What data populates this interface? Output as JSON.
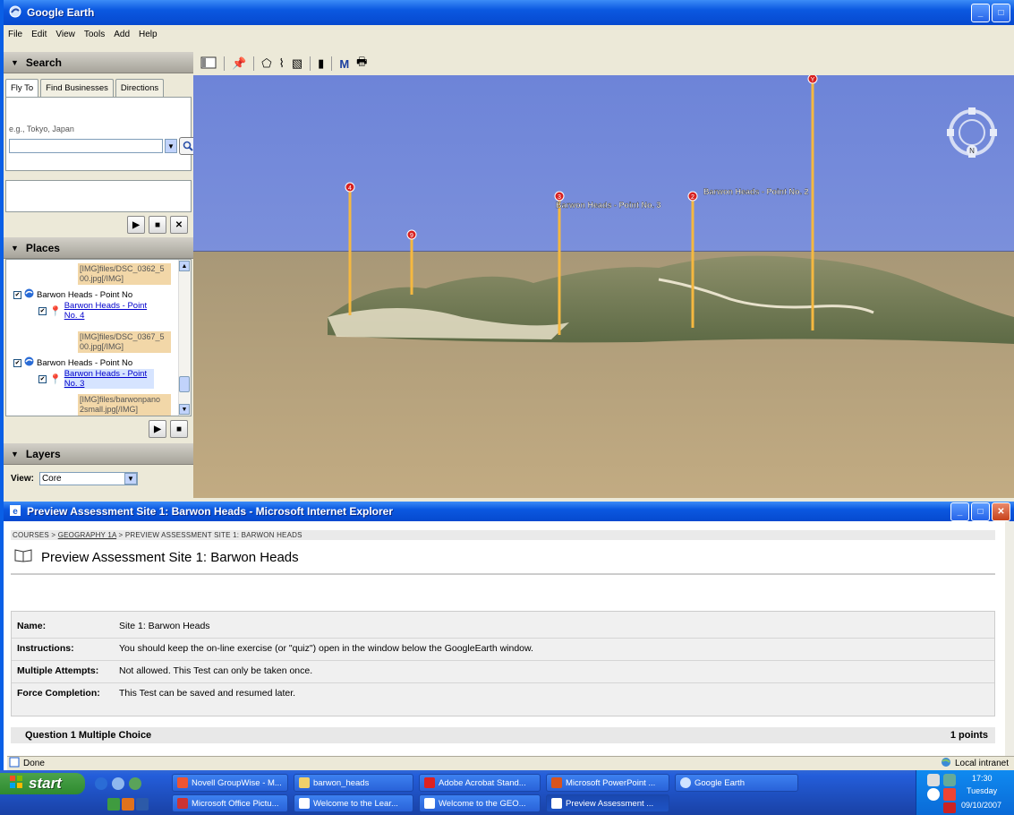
{
  "ge": {
    "title": "Google Earth",
    "menu": [
      "File",
      "Edit",
      "View",
      "Tools",
      "Add",
      "Help"
    ],
    "search": {
      "heading": "Search",
      "tabs": [
        "Fly To",
        "Find Businesses",
        "Directions"
      ],
      "hint": "e.g., Tokyo, Japan",
      "value": ""
    },
    "places": {
      "heading": "Places",
      "rows": [
        {
          "kind": "img",
          "text": "[IMG]files/DSC_0362_5 00.jpg[/IMG]"
        },
        {
          "kind": "folder",
          "text": "Barwon Heads - Point No"
        },
        {
          "kind": "pin",
          "text": "Barwon Heads - Point No. 4"
        },
        {
          "kind": "img",
          "text": "[IMG]files/DSC_0367_5 00.jpg[/IMG]"
        },
        {
          "kind": "folder",
          "text": "Barwon Heads - Point No"
        },
        {
          "kind": "pin",
          "text": "Barwon Heads - Point No. 3"
        },
        {
          "kind": "img",
          "text": "[IMG]files/barwonpano 2small.jpg[/IMG]"
        }
      ]
    },
    "layers": {
      "heading": "Layers",
      "view_label": "View:",
      "view_value": "Core"
    },
    "view": {
      "pins": [
        {
          "num": "4",
          "label": ""
        },
        {
          "num": "9",
          "label": ""
        },
        {
          "num": "3",
          "label": "Barwon Heads - Point No. 3"
        },
        {
          "num": "2",
          "label": "Barwon Heads - Point No. 2"
        },
        {
          "num": "Y",
          "label": ""
        }
      ],
      "compass": "N"
    },
    "colors": {
      "sky": "#7a8fd6",
      "ground": "#b5a27a",
      "pole": "#f5b840"
    }
  },
  "ie": {
    "title": "Preview Assessment Site 1: Barwon Heads - Microsoft Internet Explorer",
    "crumb": {
      "courses": "COURSES",
      "sep": ">",
      "course": "GEOGRAPHY 1A",
      "current": "PREVIEW ASSESSMENT SITE 1: BARWON HEADS"
    },
    "page_title": "Preview Assessment Site 1: Barwon Heads",
    "info": [
      {
        "label": "Name:",
        "value": "Site 1: Barwon Heads"
      },
      {
        "label": "Instructions:",
        "value": "You should keep the on-line exercise (or \"quiz\") open in the window below the GoogleEarth window."
      },
      {
        "label": "Multiple Attempts:",
        "value": "Not allowed. This Test can only be taken once."
      },
      {
        "label": "Force Completion:",
        "value": "This Test can be saved and resumed later."
      }
    ],
    "question": {
      "label": "Question 1  Multiple Choice",
      "points": "1 points"
    },
    "status": {
      "text": "Done",
      "zone": "Local intranet"
    }
  },
  "taskbar": {
    "start": "start",
    "row1": [
      "Novell GroupWise - M...",
      "barwon_heads",
      "Adobe Acrobat Stand...",
      "Microsoft PowerPoint ...",
      "Google Earth"
    ],
    "row2": [
      "Microsoft Office Pictu...",
      "Welcome to the Lear...",
      "Welcome to the GEO...",
      "Preview Assessment ..."
    ],
    "clock": {
      "time": "17:30",
      "day": "Tuesday",
      "date": "09/10/2007"
    }
  }
}
